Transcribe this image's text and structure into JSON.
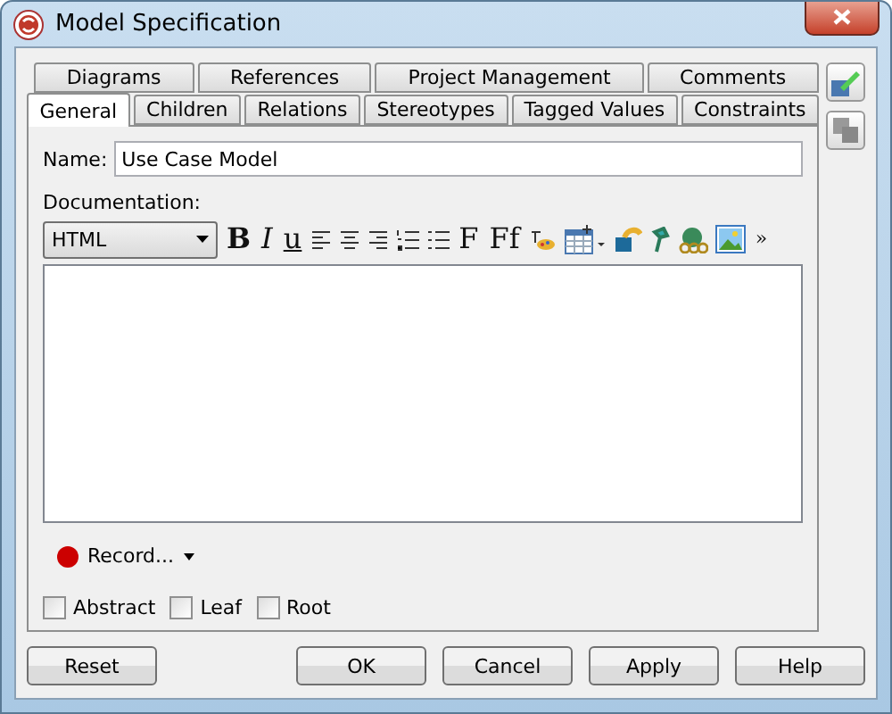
{
  "window": {
    "title": "Model Specification"
  },
  "tabs_back": [
    {
      "label": "Diagrams",
      "selected": false
    },
    {
      "label": "References",
      "selected": false
    },
    {
      "label": "Project Management",
      "selected": false
    },
    {
      "label": "Comments",
      "selected": false
    }
  ],
  "tabs_front": [
    {
      "label": "General",
      "selected": true
    },
    {
      "label": "Children",
      "selected": false
    },
    {
      "label": "Relations",
      "selected": false
    },
    {
      "label": "Stereotypes",
      "selected": false
    },
    {
      "label": "Tagged Values",
      "selected": false
    },
    {
      "label": "Constraints",
      "selected": false
    }
  ],
  "name": {
    "label": "Name:",
    "value": "Use Case Model"
  },
  "documentation": {
    "label": "Documentation:",
    "format": "HTML",
    "toolbar": [
      {
        "kind": "glyph",
        "label": "B"
      },
      {
        "kind": "glyph",
        "label": "I"
      },
      {
        "kind": "glyph",
        "label": "u"
      },
      {
        "kind": "icon"
      },
      {
        "kind": "icon"
      },
      {
        "kind": "icon"
      },
      {
        "kind": "icon"
      },
      {
        "kind": "icon"
      },
      {
        "kind": "glyph",
        "label": "F"
      },
      {
        "kind": "glyph",
        "label": "Ff"
      },
      {
        "kind": "icon"
      },
      {
        "kind": "icon"
      },
      {
        "kind": "icon"
      },
      {
        "kind": "icon"
      },
      {
        "kind": "icon"
      },
      {
        "kind": "icon"
      },
      {
        "kind": "glyph",
        "label": "»"
      }
    ]
  },
  "record": {
    "label": "Record..."
  },
  "checkboxes": [
    {
      "label": "Abstract",
      "checked": false
    },
    {
      "label": "Leaf",
      "checked": false
    },
    {
      "label": "Root",
      "checked": false
    }
  ],
  "buttons": [
    {
      "label": "Reset"
    },
    {
      "label": "OK"
    },
    {
      "label": "Cancel"
    },
    {
      "label": "Apply"
    },
    {
      "label": "Help"
    }
  ]
}
